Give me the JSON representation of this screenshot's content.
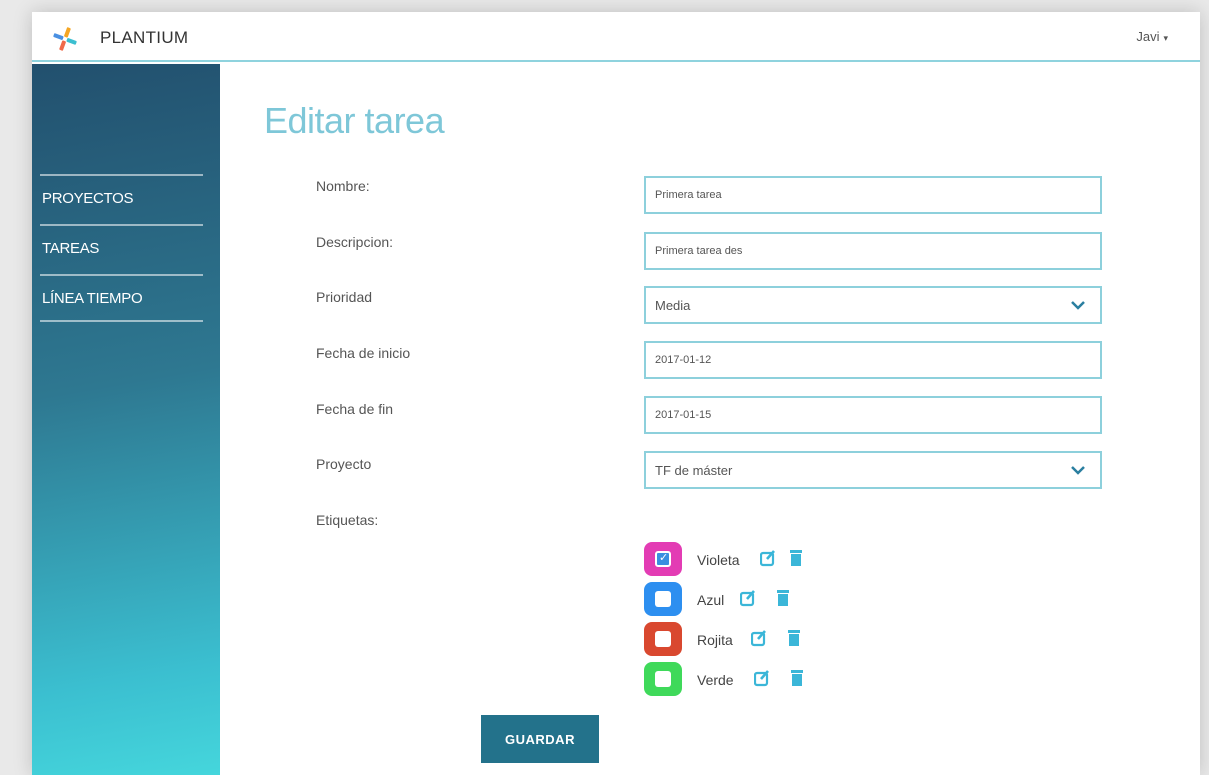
{
  "header": {
    "brand": "PLANTIUM",
    "user": "Javi",
    "user_caret": "▾"
  },
  "sidebar": {
    "items": [
      {
        "label": "PROYECTOS"
      },
      {
        "label": "TAREAS"
      },
      {
        "label": "LÍNEA TIEMPO"
      }
    ]
  },
  "page": {
    "title": "Editar tarea"
  },
  "form": {
    "nombre": {
      "label": "Nombre:",
      "value": "Primera tarea"
    },
    "descripcion": {
      "label": "Descripcion:",
      "value": "Primera tarea des"
    },
    "prioridad": {
      "label": "Prioridad",
      "value": "Media"
    },
    "fecha_inicio": {
      "label": "Fecha de inicio",
      "value": "2017-01-12"
    },
    "fecha_fin": {
      "label": "Fecha de fin",
      "value": "2017-01-15"
    },
    "proyecto": {
      "label": "Proyecto",
      "value": "TF de máster"
    },
    "etiquetas": {
      "label": "Etiquetas:"
    },
    "save_label": "GUARDAR"
  },
  "tags": [
    {
      "name": "Violeta",
      "color": "#e33cb4",
      "checked": true
    },
    {
      "name": "Azul",
      "color": "#2d8ff0",
      "checked": false
    },
    {
      "name": "Rojita",
      "color": "#d9482f",
      "checked": false
    },
    {
      "name": "Verde",
      "color": "#3fd95a",
      "checked": false
    }
  ],
  "colors": {
    "accent": "#8dd0dc",
    "button": "#23728b",
    "icon": "#3bb6d8"
  }
}
